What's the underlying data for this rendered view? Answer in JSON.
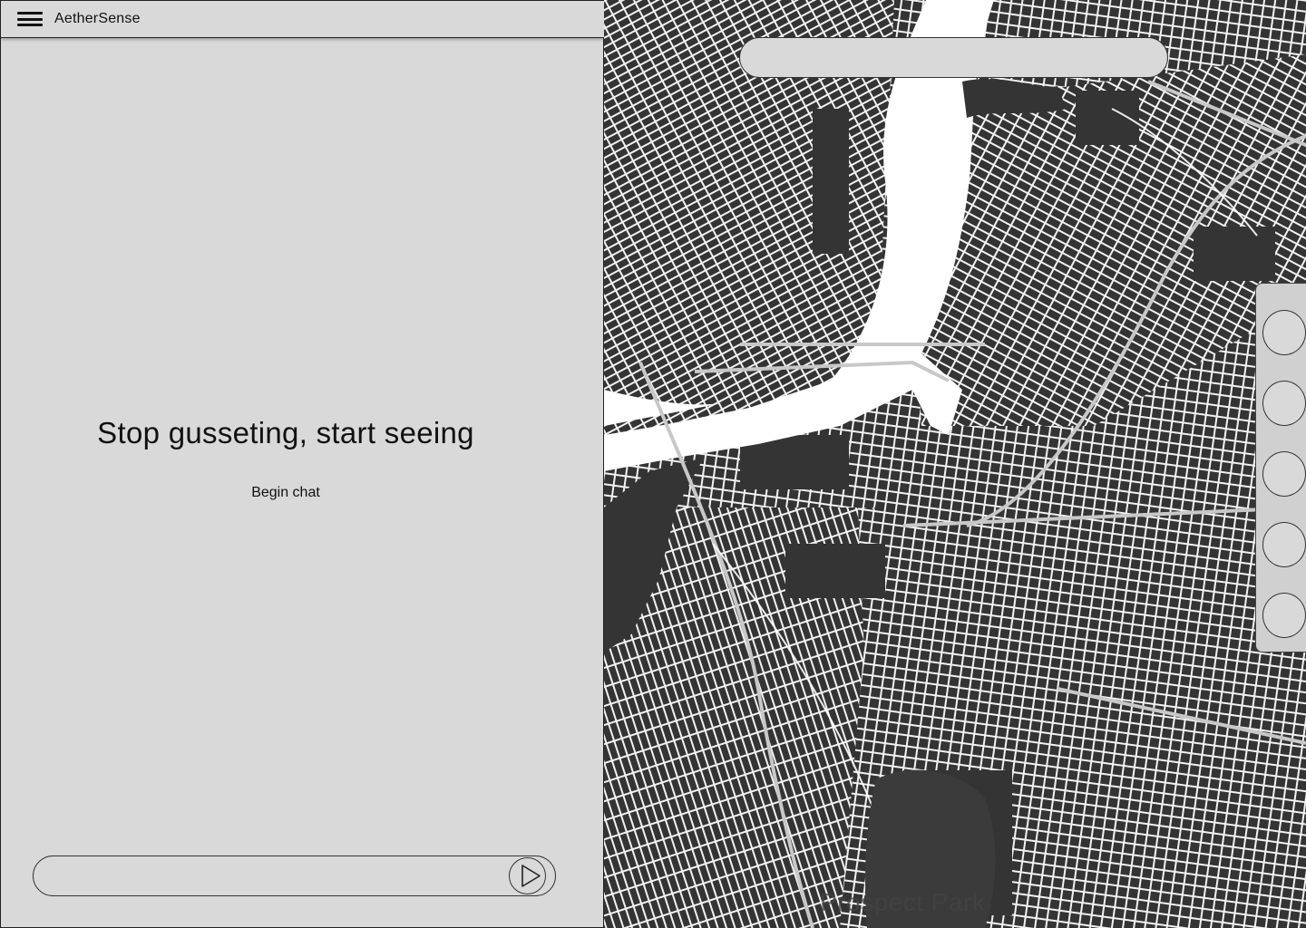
{
  "app": {
    "title": "AetherSense"
  },
  "chat": {
    "headline": "Stop gusseting, start seeing",
    "begin_chat_label": "Begin chat",
    "input_value": "",
    "input_placeholder": ""
  },
  "map": {
    "search_value": "",
    "search_placeholder": "",
    "labels": {
      "park": "Prospect Park"
    },
    "toolbar_buttons": [
      "map-tool-1",
      "map-tool-2",
      "map-tool-3",
      "map-tool-4",
      "map-tool-5"
    ]
  },
  "colors": {
    "panel_bg": "#d9d9d9",
    "map_block": "#343434",
    "map_street": "#ffffff",
    "map_water": "#ffffff"
  },
  "icons": {
    "menu": "hamburger-menu-icon",
    "send": "play-triangle-icon"
  }
}
